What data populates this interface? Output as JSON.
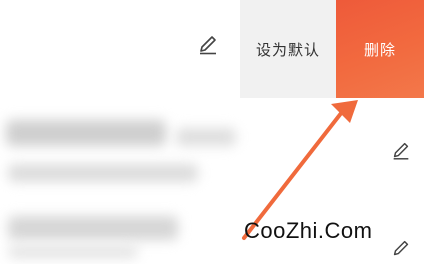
{
  "row1": {
    "set_default_label": "设为默认",
    "delete_label": "删除"
  },
  "watermark": "CooZhi.Com",
  "colors": {
    "delete_bg": "#ef5b3b",
    "default_bg": "#f1f1f1",
    "arrow": "#f06a3c"
  }
}
